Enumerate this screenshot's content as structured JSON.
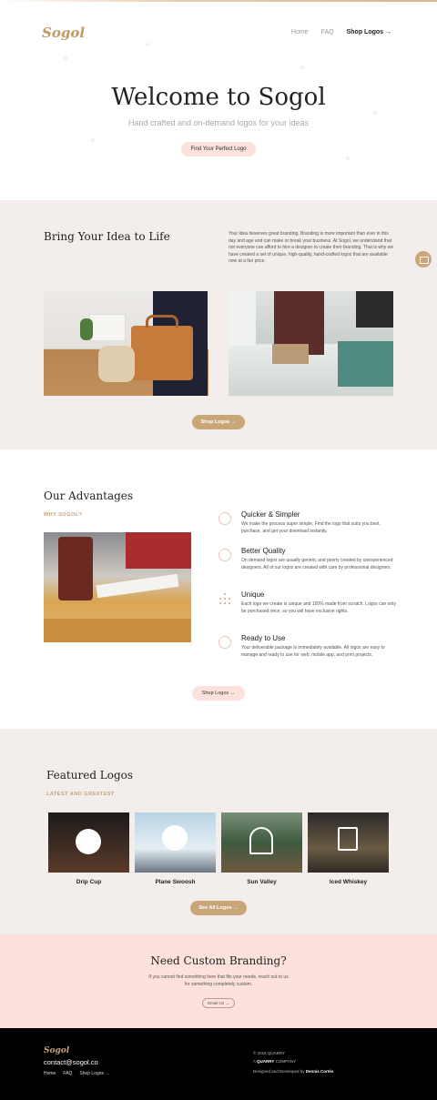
{
  "header": {
    "logo": "Sogol",
    "nav": {
      "home": "Home",
      "faq": "FAQ",
      "shop": "Shop Logos →"
    }
  },
  "hero": {
    "title": "Welcome to Sogol",
    "subtitle": "Hand crafted and on-demand logos for your ideas",
    "cta": "Find Your Perfect Logo"
  },
  "idea": {
    "title": "Bring Your Idea to Life",
    "text": "Your idea deserves great branding. Branding is more important than ever in this day and age and can make or break your business. At Sogol, we understand that not everyone can afford to hire a designer to create their branding. That is why we have created a set of unique, high-quality, hand-crafted logos that are available now at a fair price.",
    "cta": "Shop Logos →"
  },
  "advantages": {
    "title": "Our Advantages",
    "kicker": "WHY SOGOL?",
    "items": [
      {
        "title": "Quicker & Simpler",
        "text": "We make the process super simple. Find the logo that suits you best, purchase, and get your download instantly."
      },
      {
        "title": "Better Quality",
        "text": "On demand logos are usually generic and poorly created by unexperienced designers. All of our logos are created with care by professional designers."
      },
      {
        "title": "Unique",
        "text": "Each logo we create is unique and 100% made from scratch. Logos can only be purchased once, so you will have exclusive rights."
      },
      {
        "title": "Ready to Use",
        "text": "Your deliverable package is immediately available. All logos are easy to manage and ready to use for web, mobile app, and print projects."
      }
    ],
    "cta": "Shop Logos →"
  },
  "featured": {
    "title": "Featured Logos",
    "kicker": "LATEST AND GREATEST",
    "logos": [
      {
        "name": "Drip Cup"
      },
      {
        "name": "Plane Swoosh"
      },
      {
        "name": "Sun Valley"
      },
      {
        "name": "Iced Whiskey"
      }
    ],
    "cta": "See All Logos →"
  },
  "custom": {
    "title": "Need Custom Branding?",
    "text": "If you cannot find something here that fits your needs, reach out to us for something completely custom.",
    "cta": "Email Us →"
  },
  "footer": {
    "logo": "Sogol",
    "email": "contact@sogol.co",
    "links": {
      "home": "Home",
      "faq": "FAQ",
      "shop": "Shop Logos →"
    },
    "copyright": "© 2016 QUARRY",
    "company_prefix": "A ",
    "company": "QUARRY",
    "company_suffix": " COMPANY",
    "credit_prefix": "Designed and Developed by ",
    "credit_name": "Dennis Cortés"
  },
  "colors": {
    "accent": "#c8a677",
    "pink": "#fde1dc",
    "beige": "#f3eeeb",
    "footer": "#000000"
  },
  "icons": [
    "chat-icon",
    "stopwatch-icon",
    "diamond-icon",
    "dots-icon",
    "rocket-icon"
  ]
}
